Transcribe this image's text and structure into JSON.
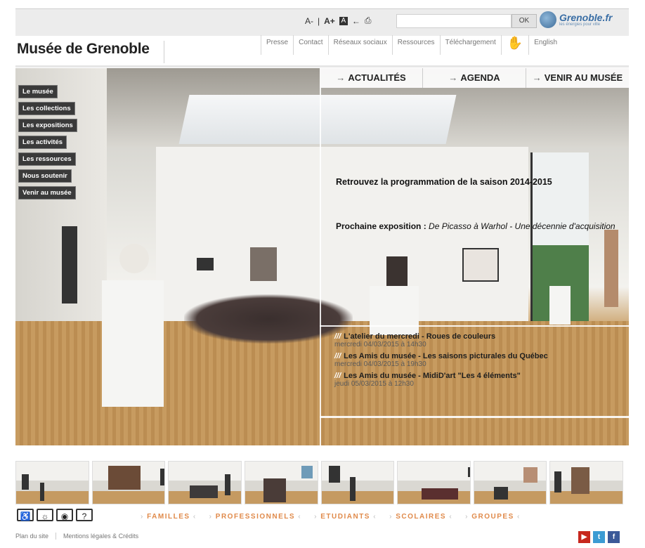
{
  "header": {
    "tools": {
      "font_smaller": "A-",
      "font_larger": "A+",
      "ok": "OK"
    },
    "logo": {
      "name": "Grenoble.fr",
      "tagline": "les énergies pour ville"
    }
  },
  "site_title": "Musée de Grenoble",
  "utility_nav": [
    "Presse",
    "Contact",
    "Réseaux sociaux",
    "Ressources",
    "Téléchargement",
    "English"
  ],
  "side_menu": [
    "Le musée",
    "Les collections",
    "Les expositions",
    "Les activités",
    "Les ressources",
    "Nous soutenir",
    "Venir au musée"
  ],
  "quick_tabs": [
    "ACTUALITÉS",
    "AGENDA",
    "VENIR AU MUSÉE"
  ],
  "promo": {
    "season": "Retrouvez la programmation de la saison 2014-2015",
    "next_label": "Prochaine exposition :",
    "next_title": "De Picasso à Warhol - Une décennie d'acquisition"
  },
  "events": [
    {
      "title": "L'atelier du mercredi - Roues de couleurs",
      "date": "mercredi 04/03/2015 à 14h30"
    },
    {
      "title": "Les Amis du musée - Les saisons picturales du Québec",
      "date": "mercredi 04/03/2015 à 19h30"
    },
    {
      "title": "Les Amis du musée - MidiD'art \"Les 4 éléments\"",
      "date": "jeudi 05/03/2015 à 12h30"
    }
  ],
  "audiences": [
    "FAMILLES",
    "PROFESSIONNELS",
    "ETUDIANTS",
    "SCOLAIRES",
    "GROUPES"
  ],
  "footer": {
    "sitemap": "Plan du site",
    "legal": "Mentions légales & Crédits"
  },
  "social": [
    "YouTube",
    "Twitter",
    "Facebook"
  ]
}
